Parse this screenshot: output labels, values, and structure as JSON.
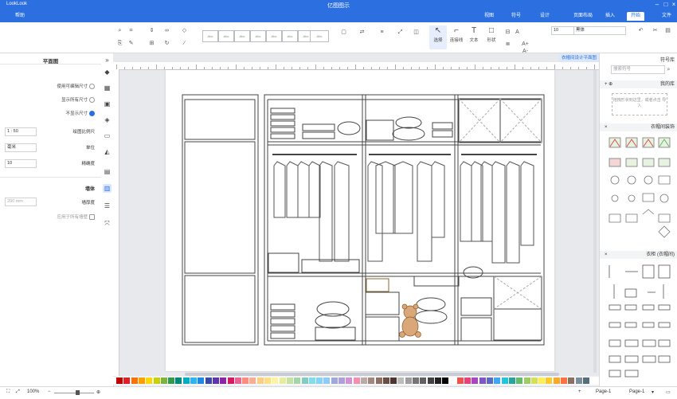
{
  "window": {
    "title": "亿图图示",
    "brand": "LookLook"
  },
  "ribbon_tabs": [
    "开始",
    "插入",
    "页面布局",
    "设计",
    "符号",
    "视图",
    "帮助"
  ],
  "ribbon_right": [
    "文件"
  ],
  "ribbon": {
    "select_label": "选择",
    "text_label": "文本",
    "connector_label": "连接线",
    "shape_label": "形状",
    "font_name": "黑体",
    "font_size": "10",
    "zoom_text": "A+ A-"
  },
  "left_panel": {
    "title": "平面图",
    "options": [
      {
        "label": "使用可编辑尺寸",
        "selected": false
      },
      {
        "label": "显示所有尺寸",
        "selected": false
      },
      {
        "label": "不显示尺寸",
        "selected": true
      }
    ],
    "fields": [
      {
        "label": "绘图比例尺",
        "value": "1 : 50"
      },
      {
        "label": "单位",
        "value": "毫米"
      },
      {
        "label": "精确度",
        "value": "10"
      }
    ],
    "wall_section": "墙体",
    "wall_thickness_label": "墙厚度",
    "wall_thickness_value": "200 mm",
    "apply_label": "应用于所有墙壁"
  },
  "doc_tab": "衣帽间设计平面图",
  "right_panel": {
    "title": "符号库",
    "search_placeholder": "搜索符号",
    "my_library": "我的库",
    "my_library_hint": "拖拽形状到这里，或者点击 导入",
    "sec1": "衣帽间装饰",
    "sec2": "衣柜 (衣帽间)"
  },
  "status": {
    "page_left": "Page-1",
    "page_tab": "Page-1",
    "zoom": "100%"
  },
  "colors": {
    "accent": "#2b6fe0",
    "palette": [
      "#c00000",
      "#e31e24",
      "#ff6f00",
      "#ffa000",
      "#ffd600",
      "#c6d300",
      "#7cb342",
      "#2e9d4b",
      "#00897b",
      "#00acc1",
      "#29b6f6",
      "#1e88e5",
      "#3949ab",
      "#5e35b1",
      "#8e24aa",
      "#d81b60",
      "#f06292",
      "#ff8a80",
      "#ffab91",
      "#ffcc80",
      "#ffe082",
      "#fff59d",
      "#e6ee9c",
      "#c5e1a5",
      "#a5d6a7",
      "#80cbc4",
      "#80deea",
      "#81d4fa",
      "#90caf9",
      "#9fa8da",
      "#b39ddb",
      "#ce93d8",
      "#f48fb1",
      "#bcaaa4",
      "#a1887f",
      "#8d6e63",
      "#6d4c41",
      "#4e342e",
      "#bdbdbd",
      "#9e9e9e",
      "#757575",
      "#616161",
      "#424242",
      "#212121",
      "#000000",
      "#ffffff",
      "#ef5350",
      "#ec407a",
      "#ab47bc",
      "#7e57c2",
      "#5c6bc0",
      "#42a5f5",
      "#26c6da",
      "#26a69a",
      "#66bb6a",
      "#9ccc65",
      "#d4e157",
      "#ffee58",
      "#ffca28",
      "#ffa726",
      "#ff7043",
      "#8d6e63",
      "#78909c",
      "#546e7a"
    ]
  }
}
